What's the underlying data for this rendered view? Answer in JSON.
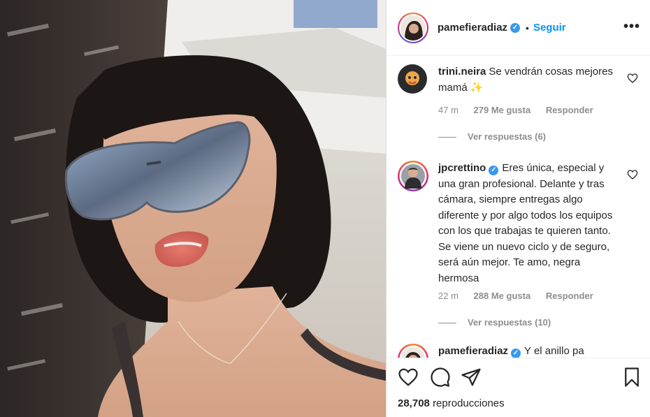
{
  "post": {
    "username": "pamefieradiaz",
    "follow_label": "Seguir",
    "more_icon": "more-options-icon"
  },
  "comments": [
    {
      "user": "trini.neira",
      "verified": false,
      "text": "Se vendrán cosas mejores mamá ✨",
      "time": "47 m",
      "likes": "279 Me gusta",
      "reply_label": "Responder",
      "view_replies": "Ver respuestas (6)"
    },
    {
      "user": "jpcrettino",
      "verified": true,
      "text": "Eres única, especial y una gran profesional. Delante y tras cámara, siempre entregas algo diferente y por algo todos los equipos con los que trabajas te quieren tanto. Se viene un nuevo ciclo y de seguro, será aún mejor. Te amo, negra hermosa",
      "time": "22 m",
      "likes": "288 Me gusta",
      "reply_label": "Responder",
      "view_replies": "Ver respuestas (10)"
    },
    {
      "user": "pamefieradiaz",
      "verified": true,
      "text": "Y el anillo pa"
    }
  ],
  "actions": {
    "like_icon": "heart-icon",
    "comment_icon": "comment-icon",
    "share_icon": "share-icon",
    "save_icon": "bookmark-icon"
  },
  "views": {
    "count": "28,708",
    "label": "reproducciones"
  },
  "colors": {
    "accent": "#0095f6",
    "verified": "#3897f0",
    "text": "#262626",
    "muted": "#8e8e8e"
  }
}
